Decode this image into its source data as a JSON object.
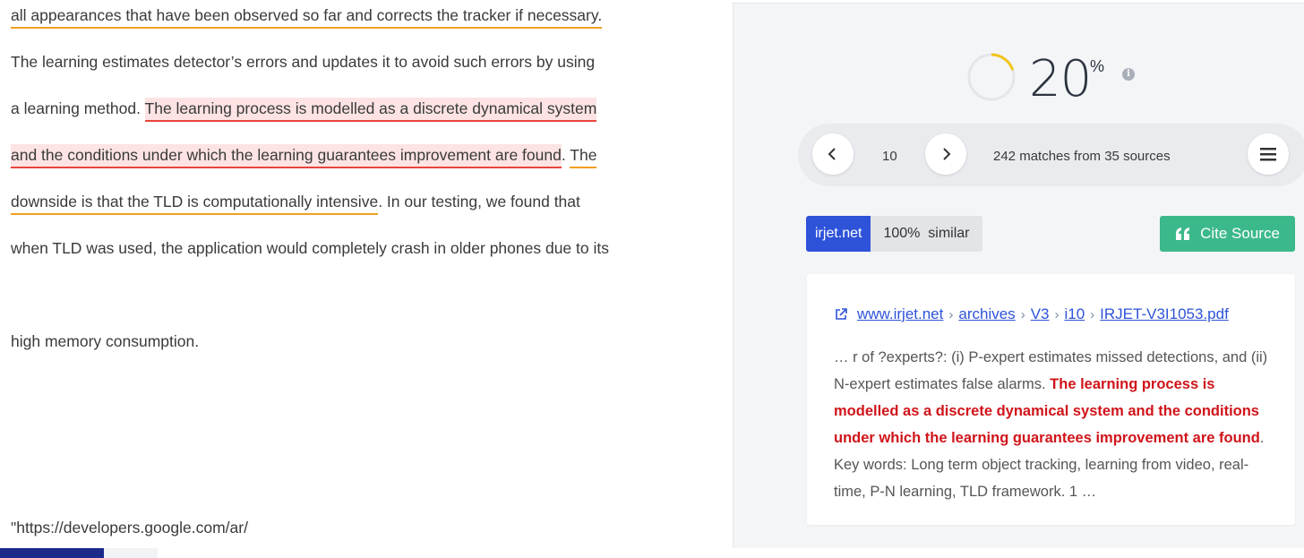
{
  "document": {
    "line1": "all appearances that have been observed so far and corrects the tracker if necessary.",
    "line2": "The learning estimates detector’s errors and updates it to avoid such errors by using",
    "line3_plain": "a learning method. ",
    "line3_highlight": "The learning process is modelled as a discrete dynamical system",
    "line4_highlight": "and the conditions under which the learning guarantees improvement are found",
    "line4_after": ". ",
    "line4_orange": "The",
    "line5_orange": "downside is that the TLD is computationally intensive",
    "line5_after": ". In our testing, we found that",
    "line6": "when TLD was used, the application would completely crash in older phones due to its",
    "line7": "high memory consumption.",
    "line8": "\"https://developers.google.com/ar/"
  },
  "score": {
    "value": "20",
    "unit": "%",
    "percent": 20,
    "ring_color": "#f2c41a",
    "track_color": "#e4e6ea",
    "info_icon": "info-icon"
  },
  "nav": {
    "prev_icon": "chevron-left-icon",
    "next_icon": "chevron-right-icon",
    "page": "10",
    "matches_text": "242 matches from 35 sources",
    "menu_icon": "hamburger-menu-icon"
  },
  "source": {
    "name": "irjet.net",
    "similarity": "100%",
    "similar_label": "similar",
    "cite_label": "Cite Source",
    "cite_icon": "quote-icon"
  },
  "card": {
    "link_icon": "external-link-icon",
    "breadcrumbs": [
      "www.irjet.net",
      "archives",
      "V3",
      "i10",
      "IRJET-V3I1053.pdf"
    ],
    "excerpt_before": "…  r of ?experts?: (i) P-expert estimates missed detections, and (ii) N-expert estimates false alarms. ",
    "excerpt_match": "The learning process is modelled as a discrete dynamical system and the conditions under which the learning guarantees improvement are found",
    "excerpt_after": ". Key words: Long term object tracking, learning from video, real-time, P-N learning, TLD framework. 1  …"
  },
  "colors": {
    "highlight_bg": "#fde3e3",
    "highlight_line": "#e8453c",
    "orange_line": "#f0a020",
    "accent_blue": "#2e53d9",
    "cite_green": "#3cb98a",
    "match_red": "#d0141a"
  }
}
